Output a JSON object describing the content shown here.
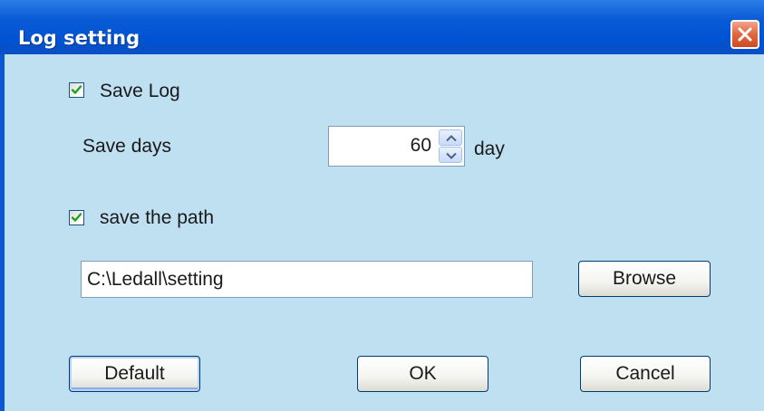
{
  "window": {
    "title": "Log setting",
    "close_icon": "close-x-icon",
    "title_bar_color": "#0b5bd6",
    "close_button_color": "#e0663f",
    "body_color": "#bfe0f1"
  },
  "save_log": {
    "checked": true,
    "label": "Save Log",
    "icon": "checkmark-icon"
  },
  "save_days": {
    "label": "Save days",
    "value": "60",
    "unit": "day",
    "up_icon": "chevron-up-icon",
    "down_icon": "chevron-down-icon"
  },
  "save_path": {
    "checked": true,
    "label": "save the path",
    "icon": "checkmark-icon",
    "value": "C:\\Ledall\\setting"
  },
  "buttons": {
    "browse": "Browse",
    "default": "Default",
    "ok": "OK",
    "cancel": "Cancel"
  }
}
